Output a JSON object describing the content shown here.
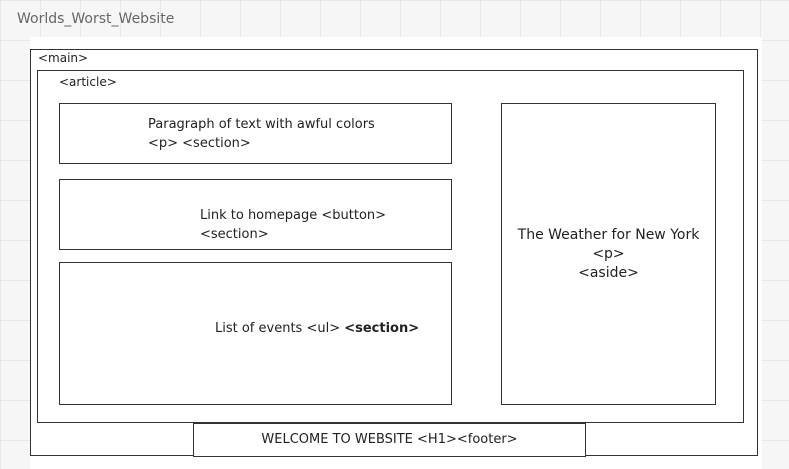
{
  "board": {
    "title": "Worlds_Worst_Website"
  },
  "main": {
    "label": "<main>"
  },
  "article": {
    "label": "<article>"
  },
  "sections": {
    "paragraph": {
      "line1": "Paragraph of text with awful colors",
      "line2": "<p> <section>"
    },
    "link": {
      "text": "Link to homepage <button> <section>"
    },
    "events": {
      "text": "List of events <ul> ",
      "bold": "<section>"
    }
  },
  "aside": {
    "line1": "The Weather for New York",
    "line2": "<p>",
    "line3": "<aside>"
  },
  "footer": {
    "text": "WELCOME TO WEBSITE <H1><footer>"
  }
}
